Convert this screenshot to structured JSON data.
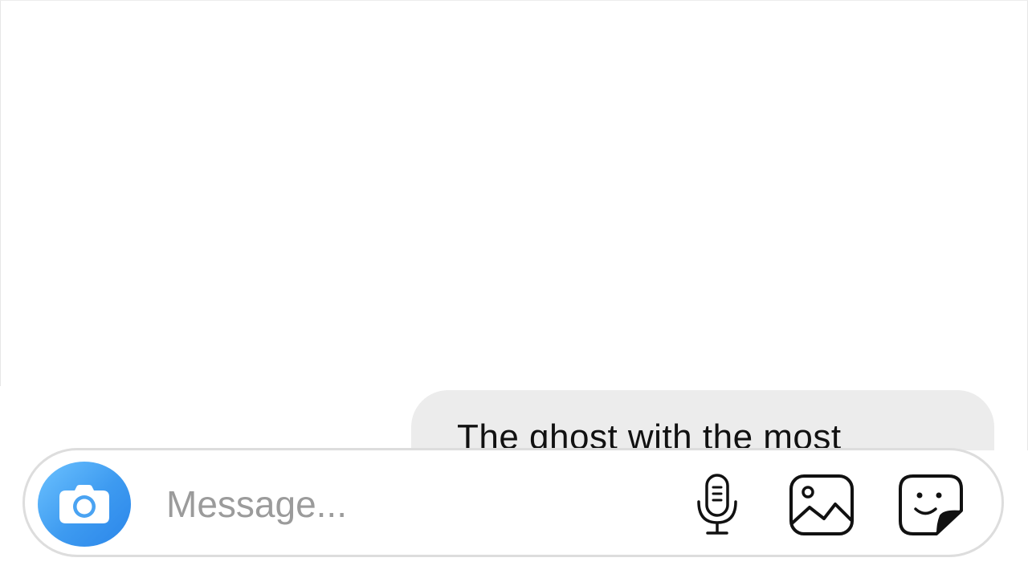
{
  "thread": {
    "messages": [
      {
        "sender": "me",
        "text": "The ghost with the most"
      }
    ]
  },
  "composer": {
    "placeholder": "Message...",
    "value": "",
    "camera_icon": "camera-icon",
    "actions": [
      {
        "icon": "microphone-icon",
        "label": "Voice message"
      },
      {
        "icon": "gallery-icon",
        "label": "Photo gallery"
      },
      {
        "icon": "sticker-icon",
        "label": "Stickers"
      }
    ]
  },
  "colors": {
    "accent": "#3d9af0",
    "bubble": "#ececec",
    "placeholder": "#9b9b9b",
    "border": "#dddddd"
  }
}
